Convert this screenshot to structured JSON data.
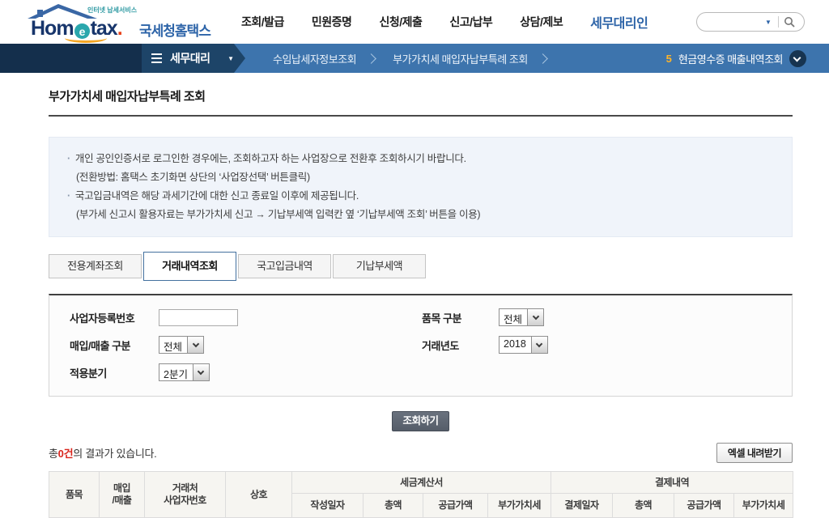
{
  "header": {
    "logo": {
      "brand_hom": "Hom",
      "brand_e": "e",
      "brand_tax": "tax",
      "brand_dot": ".",
      "tagline": "인터넷 납세서비스",
      "org": "국세청홈택스"
    },
    "nav": [
      {
        "label": "조회/발급",
        "active": false
      },
      {
        "label": "민원증명",
        "active": false
      },
      {
        "label": "신청/제출",
        "active": false
      },
      {
        "label": "신고/납부",
        "active": false
      },
      {
        "label": "상담/제보",
        "active": false
      },
      {
        "label": "세무대리인",
        "active": true
      }
    ],
    "search": {
      "value": "",
      "placeholder": "",
      "dropdown_icon": "▼"
    }
  },
  "gnb": {
    "menu_label": "세무대리",
    "menu_caret": "▼",
    "crumbs": [
      "수임납세자정보조회",
      "부가가치세 매입자납부특례 조회"
    ],
    "quick": {
      "number": "5",
      "label": "현금영수증 매출내역조회"
    }
  },
  "page": {
    "title": "부가가치세 매입자납부특례 조회"
  },
  "notice": {
    "items": [
      {
        "text": "개인 공인인증서로 로그인한 경우에는, 조회하고자 하는 사업장으로 전환후 조회하시기 바랍니다.",
        "sub": "(전환방법: 홈택스 초기화면 상단의 ‘사업장선택’ 버튼클릭)"
      },
      {
        "text": "국고입금내역은 해당 과세기간에 대한 신고 종료일 이후에 제공됩니다.",
        "sub": "(부가세 신고시 활용자료는 부가가치세 신고 → 기납부세액 입력칸 옆 ‘기납부세액 조회’ 버튼을 이용)"
      }
    ]
  },
  "tabs": [
    {
      "label": "전용계좌조회",
      "active": false
    },
    {
      "label": "거래내역조회",
      "active": true
    },
    {
      "label": "국고입금내역",
      "active": false
    },
    {
      "label": "기납부세액",
      "active": false
    }
  ],
  "form": {
    "biz_no": {
      "label": "사업자등록번호",
      "value": ""
    },
    "inout": {
      "label": "매입/매출 구분",
      "value": "전체"
    },
    "quarter": {
      "label": "적용분기",
      "value": "2분기"
    },
    "item": {
      "label": "품목 구분",
      "value": "전체"
    },
    "year": {
      "label": "거래년도",
      "value": "2018"
    },
    "submit_label": "조회하기"
  },
  "results": {
    "prefix": "총",
    "count": "0건",
    "suffix": "의 결과가 있습니다.",
    "excel_label": "엑셀 내려받기"
  },
  "table": {
    "col_product": "품목",
    "col_inout_l1": "매입",
    "col_inout_l2": "/매출",
    "col_bizno_l1": "거래처",
    "col_bizno_l2": "사업자번호",
    "col_name": "상호",
    "group_tax": "세금계산서",
    "group_pay": "결제내역",
    "sub_tax": [
      "작성일자",
      "총액",
      "공급가액",
      "부가가치세"
    ],
    "sub_pay": [
      "결제일자",
      "총액",
      "공급가액",
      "부가가치세"
    ],
    "rows": []
  },
  "colors": {
    "accent_blue": "#2d64a8",
    "bar_blue": "#3d74ad",
    "dark_navy": "#142f4c",
    "menu_navy": "#1d4468",
    "orange": "#ffb429",
    "red": "#d9251d",
    "teal": "#2aa7ad"
  }
}
